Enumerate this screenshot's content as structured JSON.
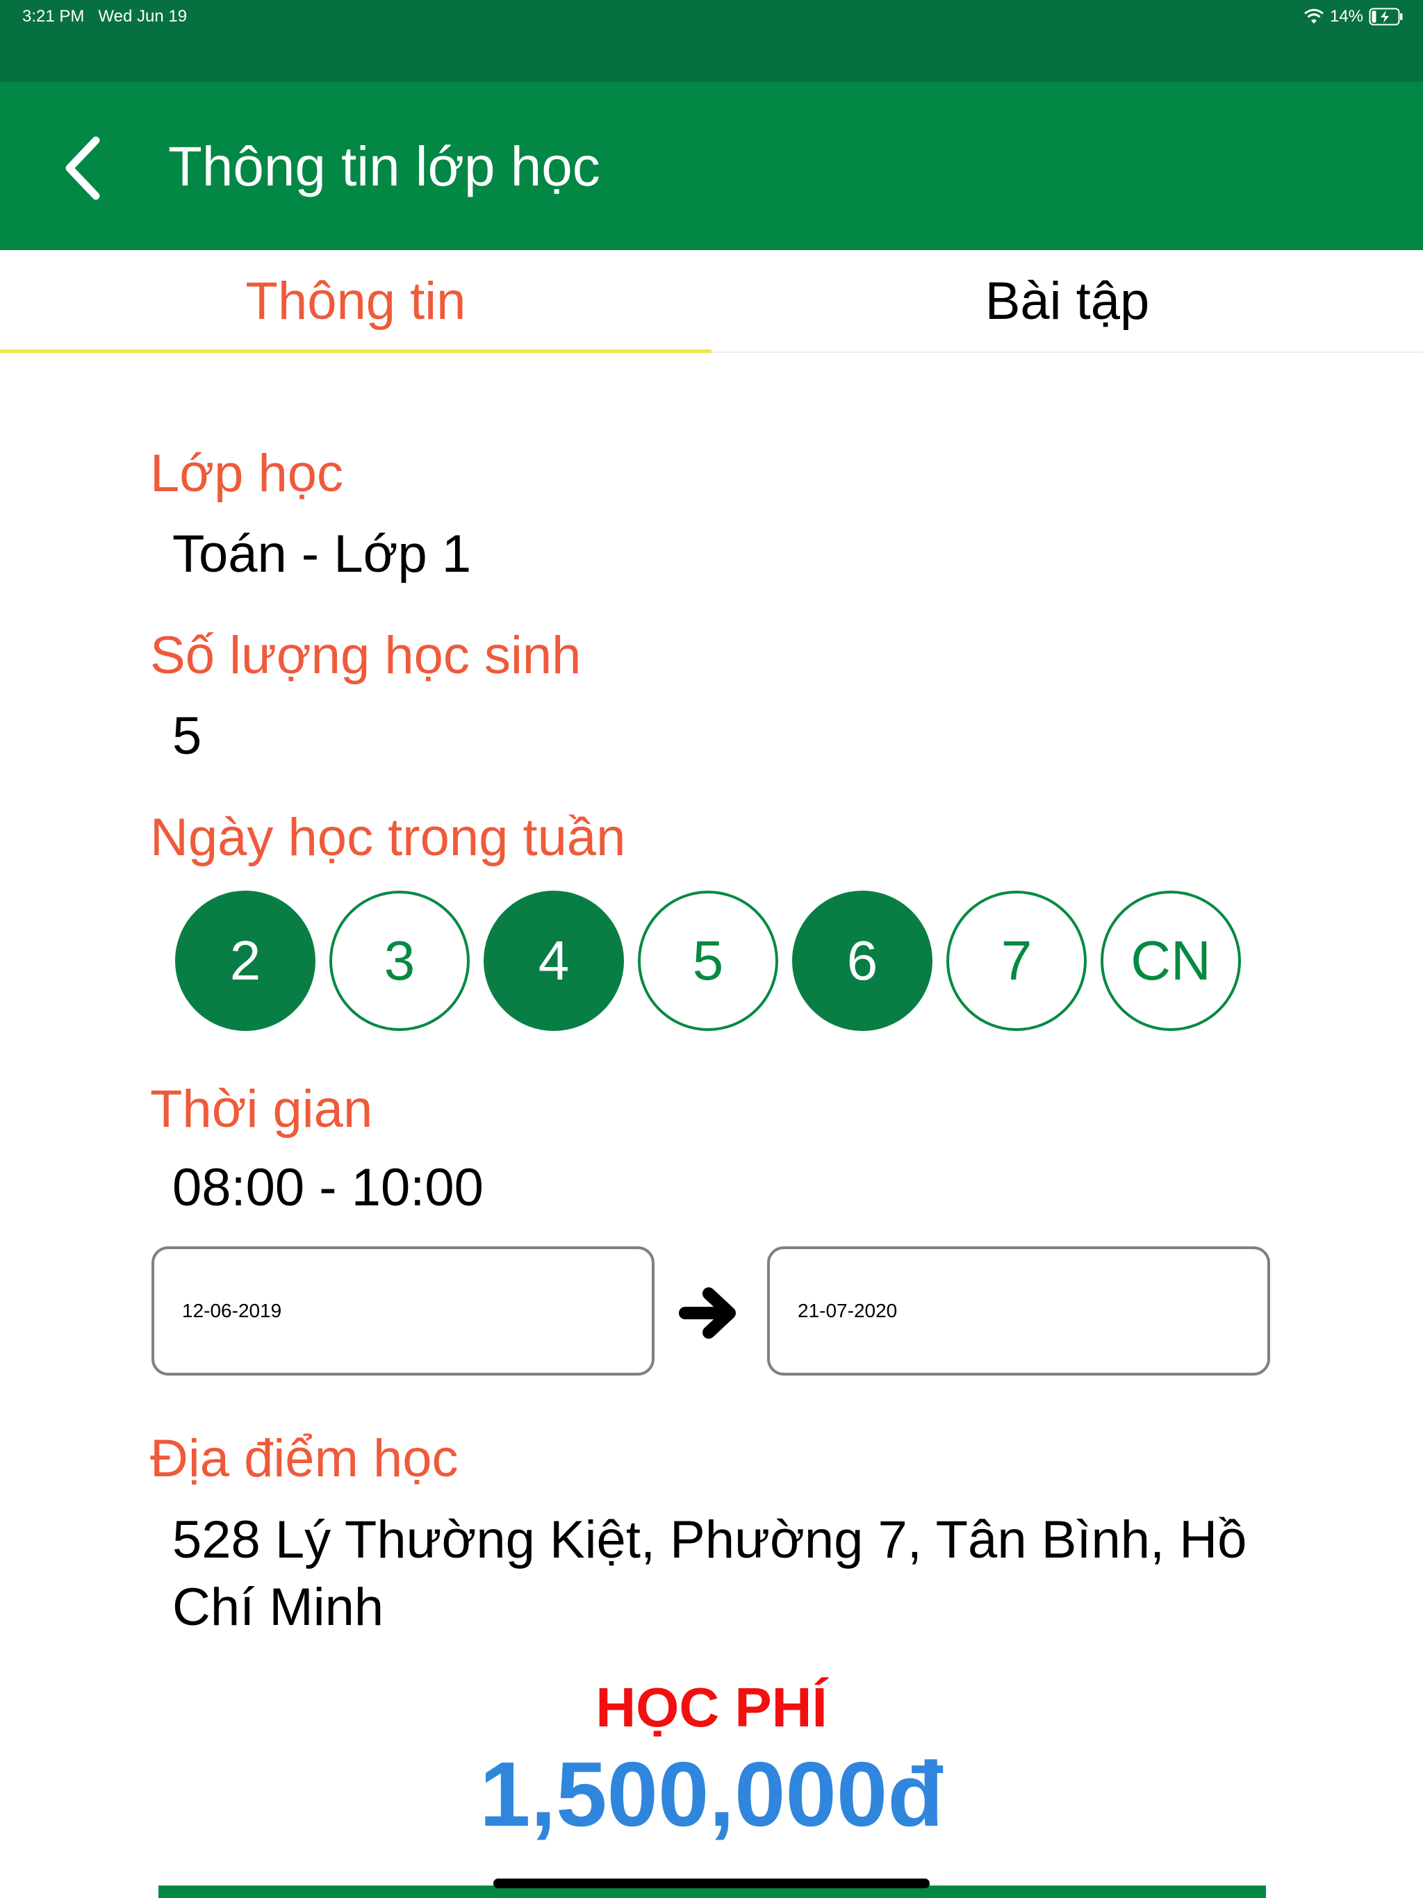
{
  "status_bar": {
    "time": "3:21 PM",
    "date": "Wed Jun 19",
    "battery": "14%"
  },
  "nav": {
    "title": "Thông tin lớp học",
    "back_icon": "chevron-left-icon"
  },
  "tabs": [
    {
      "label": "Thông tin",
      "active": true
    },
    {
      "label": "Bài tập",
      "active": false
    }
  ],
  "class_info": {
    "class_label": "Lớp học",
    "class_value": "Toán - Lớp 1",
    "students_label": "Số lượng học sinh",
    "students_value": "5",
    "days_label": "Ngày học trong tuần",
    "days": [
      {
        "label": "2",
        "selected": true
      },
      {
        "label": "3",
        "selected": false
      },
      {
        "label": "4",
        "selected": true
      },
      {
        "label": "5",
        "selected": false
      },
      {
        "label": "6",
        "selected": true
      },
      {
        "label": "7",
        "selected": false
      },
      {
        "label": "CN",
        "selected": false
      }
    ],
    "time_label": "Thời gian",
    "time_value": "08:00 - 10:00",
    "start_date": "12-06-2019",
    "end_date": "21-07-2020",
    "location_label": "Địa điểm học",
    "location_value": "528 Lý Thường Kiệt, Phường 7, Tân Bình, Hồ Chí Minh"
  },
  "fee": {
    "label": "HỌC PHÍ",
    "amount": "1,500,000đ"
  },
  "colors": {
    "status_bar": "#067040",
    "nav_bar": "#038745",
    "label": "#EE5A3A",
    "day_selected": "#087E45",
    "tab_indicator": "#F3E54C",
    "fee_label": "#F01010",
    "fee_amount": "#2F86DC"
  }
}
